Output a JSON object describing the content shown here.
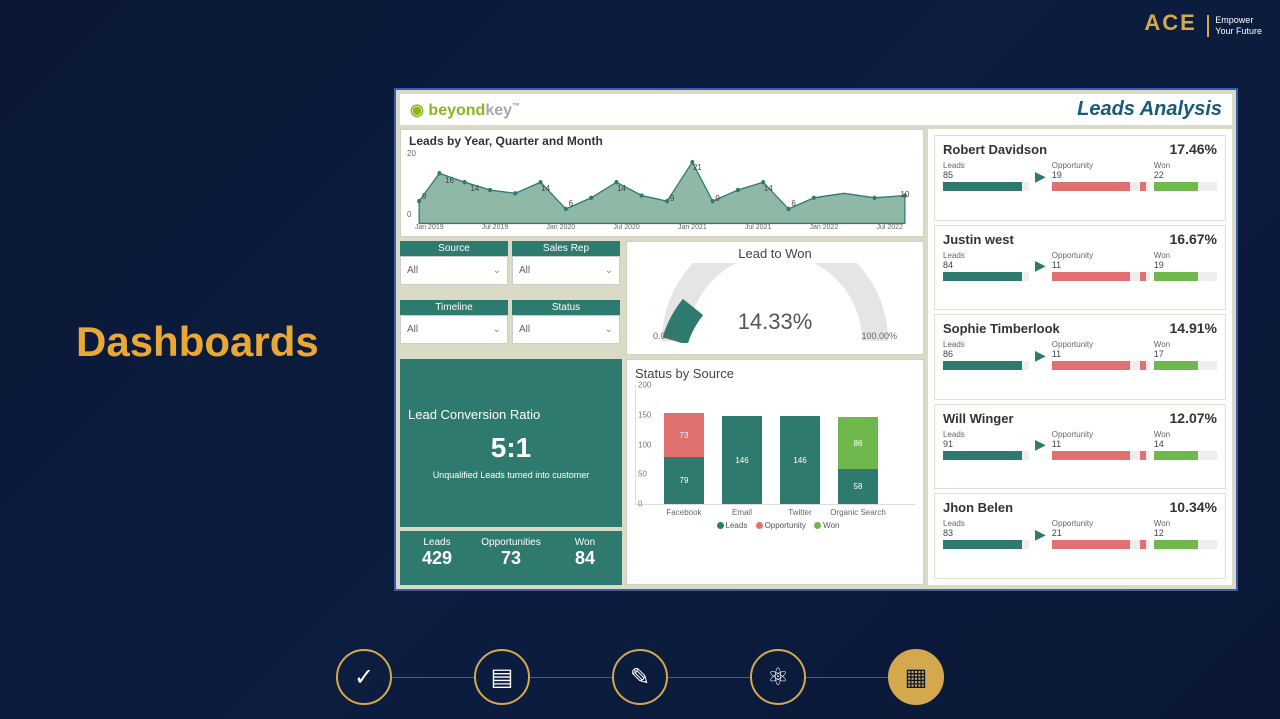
{
  "ace": {
    "brand": "ACE",
    "tag1": "Empower",
    "tag2": "Your Future"
  },
  "slide_title": "Dashboards",
  "logo": {
    "o": "◉",
    "p1": "beyond",
    "p2": "key",
    "tm": "™"
  },
  "header_right": "Leads Analysis",
  "timeseries": {
    "title": "Leads by Year, Quarter and Month",
    "yticks": [
      "0",
      "20"
    ],
    "xticks": [
      "Jan 2019",
      "Jul 2019",
      "Jan 2020",
      "Jul 2020",
      "Jan 2021",
      "Jul 2021",
      "Jan 2022",
      "Jul 2022"
    ],
    "labels": [
      "9",
      "16",
      "14",
      "",
      "",
      "14",
      "6",
      "",
      "14",
      "",
      "9",
      "21",
      "9",
      "",
      "14",
      "6",
      "",
      "10"
    ]
  },
  "filters": [
    {
      "label": "Source",
      "value": "All"
    },
    {
      "label": "Sales Rep",
      "value": "All"
    },
    {
      "label": "Timeline",
      "value": "All"
    },
    {
      "label": "Status",
      "value": "All"
    }
  ],
  "gauge": {
    "title": "Lead to Won",
    "value": "14.33%",
    "min": "0.00%",
    "max": "100.00%"
  },
  "conversion": {
    "title": "Lead Conversion Ratio",
    "ratio": "5:1",
    "subtitle": "Unqualified Leads turned into customer"
  },
  "stats": [
    {
      "label": "Leads",
      "value": "429"
    },
    {
      "label": "Opportunities",
      "value": "73"
    },
    {
      "label": "Won",
      "value": "84"
    }
  ],
  "status_by_source": {
    "title": "Status by Source",
    "yticks": [
      "0",
      "50",
      "100",
      "150",
      "200"
    ],
    "legend": {
      "leads": "Leads",
      "opp": "Opportunity",
      "won": "Won"
    },
    "bars": [
      {
        "cat": "Facebook",
        "leads": 79,
        "opp": 73,
        "won": 0
      },
      {
        "cat": "Email",
        "leads": 146,
        "opp": 0,
        "won": 0
      },
      {
        "cat": "Twitter",
        "leads": 146,
        "opp": 0,
        "won": 0
      },
      {
        "cat": "Organic Search",
        "leads": 58,
        "opp": 0,
        "won": 86
      }
    ]
  },
  "reps": [
    {
      "name": "Robert Davidson",
      "pct": "17.46%",
      "leads": "85",
      "opp": "19",
      "won": "22"
    },
    {
      "name": "Justin west",
      "pct": "16.67%",
      "leads": "84",
      "opp": "11",
      "won": "19"
    },
    {
      "name": "Sophie Timberlook",
      "pct": "14.91%",
      "leads": "86",
      "opp": "11",
      "won": "17"
    },
    {
      "name": "Will Winger",
      "pct": "12.07%",
      "leads": "91",
      "opp": "11",
      "won": "14"
    },
    {
      "name": "Jhon Belen",
      "pct": "10.34%",
      "leads": "83",
      "opp": "21",
      "won": "12"
    }
  ],
  "labels": {
    "leads": "Leads",
    "opportunity": "Opportunity",
    "won": "Won"
  },
  "chart_data": {
    "timeseries": {
      "type": "line",
      "title": "Leads by Year, Quarter and Month",
      "ylabel": "",
      "ylim": [
        0,
        20
      ],
      "x": [
        "Jan 2019",
        "Jul 2019",
        "Jan 2020",
        "Jul 2020",
        "Jan 2021",
        "Jul 2021",
        "Jan 2022",
        "Jul 2022"
      ],
      "points_sample": [
        9,
        16,
        14,
        11,
        10,
        14,
        6,
        9,
        14,
        10,
        9,
        21,
        9,
        11,
        14,
        6,
        9,
        10
      ]
    },
    "gauge": {
      "type": "gauge",
      "title": "Lead to Won",
      "value": 14.33,
      "min": 0,
      "max": 100,
      "unit": "%"
    },
    "status_by_source": {
      "type": "bar",
      "stacked": true,
      "title": "Status by Source",
      "categories": [
        "Facebook",
        "Email",
        "Twitter",
        "Organic Search"
      ],
      "series": [
        {
          "name": "Leads",
          "values": [
            79,
            146,
            146,
            58
          ]
        },
        {
          "name": "Opportunity",
          "values": [
            73,
            0,
            0,
            0
          ]
        },
        {
          "name": "Won",
          "values": [
            0,
            0,
            0,
            86
          ]
        }
      ],
      "ylim": [
        0,
        200
      ]
    },
    "reps": {
      "type": "table",
      "columns": [
        "Name",
        "Percent",
        "Leads",
        "Opportunity",
        "Won"
      ],
      "rows": [
        [
          "Robert Davidson",
          17.46,
          85,
          19,
          22
        ],
        [
          "Justin west",
          16.67,
          84,
          11,
          19
        ],
        [
          "Sophie Timberlook",
          14.91,
          86,
          11,
          17
        ],
        [
          "Will Winger",
          12.07,
          91,
          11,
          14
        ],
        [
          "Jhon Belen",
          10.34,
          83,
          21,
          12
        ]
      ]
    },
    "conversion": {
      "type": "scalar",
      "label": "Lead Conversion Ratio",
      "value": "5:1"
    },
    "totals": {
      "Leads": 429,
      "Opportunities": 73,
      "Won": 84
    }
  }
}
